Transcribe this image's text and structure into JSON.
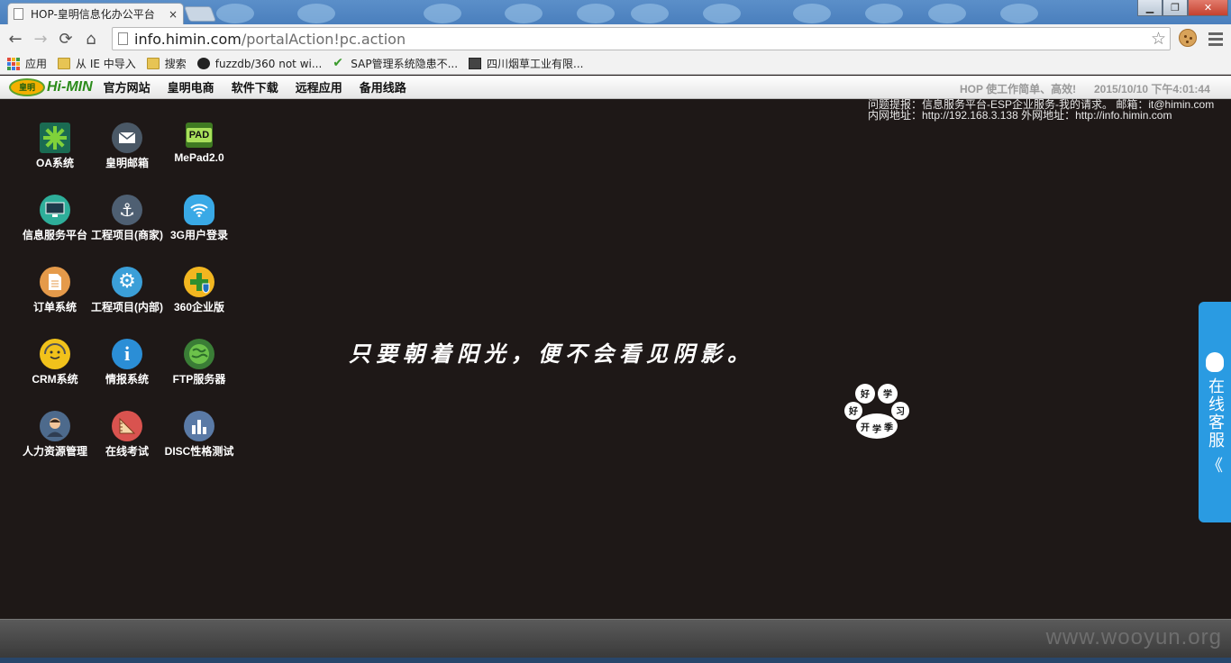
{
  "browser": {
    "tab_title": "HOP-皇明信息化办公平台",
    "tab_close": "×",
    "window_buttons": {
      "minimize": "▁",
      "restore": "❐",
      "close": "✕"
    },
    "nav": {
      "back": "←",
      "forward": "→",
      "reload": "⟳",
      "home": "⌂"
    },
    "url_host": "info.himin.com",
    "url_path": "/portalAction!pc.action",
    "star": "☆",
    "bookmarks": [
      {
        "label": "应用",
        "icon": "apps-icon"
      },
      {
        "label": "从 IE 中导入",
        "icon": "folder-icon"
      },
      {
        "label": "搜索",
        "icon": "folder-icon"
      },
      {
        "label": "fuzzdb/360 not wi...",
        "icon": "github-icon"
      },
      {
        "label": "SAP管理系统隐患不...",
        "icon": "check-icon"
      },
      {
        "label": "四川烟草工业有限...",
        "icon": "image-icon"
      }
    ]
  },
  "site": {
    "logo_mark": "皇明",
    "logo_text": "Hi-MIN",
    "nav": [
      "官方网站",
      "皇明电商",
      "软件下载",
      "远程应用",
      "备用线路"
    ],
    "slogan": "HOP 使工作简单、高效!",
    "datetime": "2015/10/10 下午4:01:44",
    "info_line1": "问题提报：信息服务平台-ESP企业服务-我的请求。 邮箱：it@himin.com",
    "info_line2": "内网地址：http://192.168.3.138 外网地址：http://info.himin.com"
  },
  "apps": [
    {
      "label": "OA系统",
      "icon": "oa-icon",
      "color": "#2aa14a"
    },
    {
      "label": "皇明邮箱",
      "icon": "mail-icon",
      "color": "#4a5866"
    },
    {
      "label": "MePad2.0",
      "icon": "pad-icon",
      "color": "#5b9a2f"
    },
    {
      "label": "信息服务平台",
      "icon": "monitor-icon",
      "color": "#2eae9a"
    },
    {
      "label": "工程项目(商家)",
      "icon": "anchor-icon",
      "color": "#4e5f72"
    },
    {
      "label": "3G用户登录",
      "icon": "wifi-icon",
      "color": "#39a9e6"
    },
    {
      "label": "订单系统",
      "icon": "document-icon",
      "color": "#e59a4a"
    },
    {
      "label": "工程项目(内部)",
      "icon": "gear-icon",
      "color": "#3b9fd8"
    },
    {
      "label": "360企业版",
      "icon": "plus-shield-icon",
      "color": "#f2b620"
    },
    {
      "label": "CRM系统",
      "icon": "smiley-headset-icon",
      "color": "#f1c21b"
    },
    {
      "label": "情报系统",
      "icon": "info-icon",
      "color": "#2b8ed6"
    },
    {
      "label": "FTP服务器",
      "icon": "globe-icon",
      "color": "#4caf50"
    },
    {
      "label": "人力资源管理",
      "icon": "person-icon",
      "color": "#4d6a8c"
    },
    {
      "label": "在线考试",
      "icon": "ruler-icon",
      "color": "#d9534f"
    },
    {
      "label": "DISC性格测试",
      "icon": "bar-chart-icon",
      "color": "#5a7aa6"
    }
  ],
  "quote": "只要朝着阳光，便不会看见阴影。",
  "paw_text": [
    "好",
    "学",
    "习",
    "好",
    "开",
    "学",
    "季"
  ],
  "kefu_label": "在线客服",
  "kefu_chevron": "《",
  "watermark": "www.wooyun.org"
}
